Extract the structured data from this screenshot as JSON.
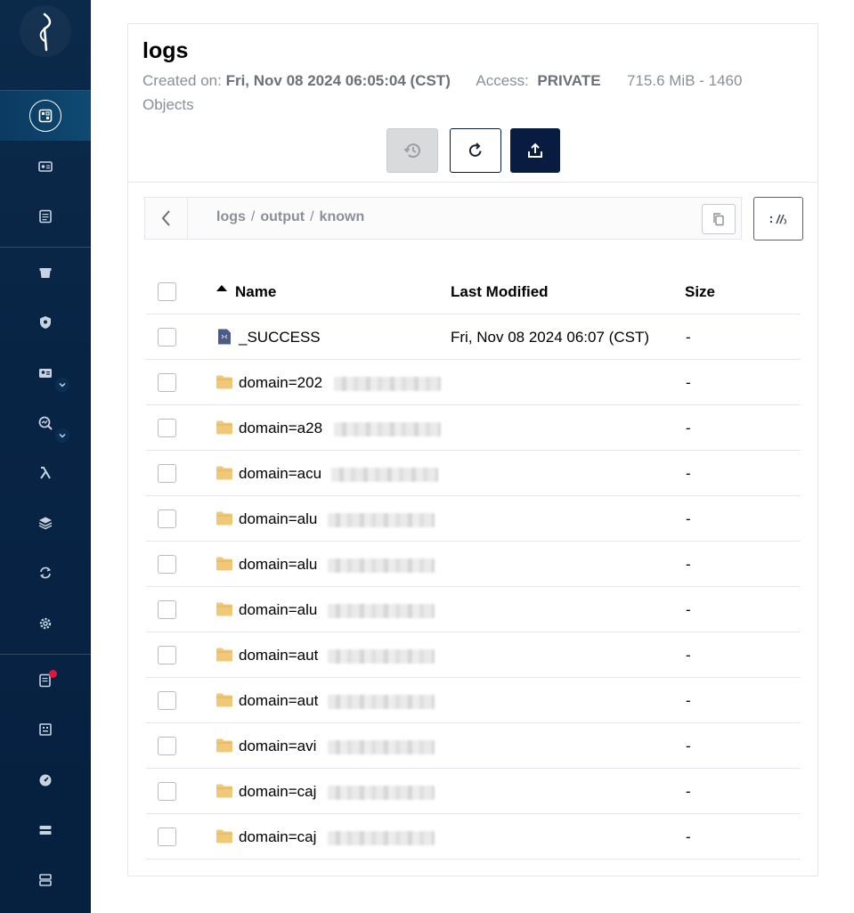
{
  "sidebar": {
    "items": [
      {
        "icon": "buckets-icon"
      },
      {
        "icon": "access-keys-icon"
      },
      {
        "icon": "documentation-icon"
      },
      {
        "icon": "storage-icon"
      },
      {
        "icon": "policies-icon"
      },
      {
        "icon": "identity-icon"
      },
      {
        "icon": "monitoring-icon"
      },
      {
        "icon": "lambda-icon"
      },
      {
        "icon": "tiers-icon"
      },
      {
        "icon": "replication-icon"
      },
      {
        "icon": "settings-icon"
      },
      {
        "icon": "license-icon"
      },
      {
        "icon": "support-icon"
      },
      {
        "icon": "metrics-icon"
      },
      {
        "icon": "drives-icon"
      },
      {
        "icon": "site-replication-icon"
      }
    ]
  },
  "bucket": {
    "name": "logs",
    "created_label": "Created on:",
    "created_value": "Fri, Nov 08 2024 06:05:04 (CST)",
    "access_label": "Access:",
    "access_value": "PRIVATE",
    "usage": "715.6 MiB - 1460 Objects"
  },
  "breadcrumb": {
    "parts": [
      "logs",
      "output",
      "known"
    ],
    "separator": "/"
  },
  "table": {
    "headers": {
      "name": "Name",
      "modified": "Last Modified",
      "size": "Size"
    },
    "rows": [
      {
        "type": "file",
        "name": "_SUCCESS",
        "modified": "Fri, Nov 08 2024 06:07 (CST)",
        "size": "-"
      },
      {
        "type": "folder",
        "name": "domain=202",
        "modified": "",
        "size": "-"
      },
      {
        "type": "folder",
        "name": "domain=a28",
        "modified": "",
        "size": "-"
      },
      {
        "type": "folder",
        "name": "domain=acu",
        "modified": "",
        "size": "-"
      },
      {
        "type": "folder",
        "name": "domain=alu",
        "modified": "",
        "size": "-"
      },
      {
        "type": "folder",
        "name": "domain=alu",
        "modified": "",
        "size": "-"
      },
      {
        "type": "folder",
        "name": "domain=alu",
        "modified": "",
        "size": "-"
      },
      {
        "type": "folder",
        "name": "domain=aut",
        "modified": "",
        "size": "-"
      },
      {
        "type": "folder",
        "name": "domain=aut",
        "modified": "",
        "size": "-"
      },
      {
        "type": "folder",
        "name": "domain=avi",
        "modified": "",
        "size": "-"
      },
      {
        "type": "folder",
        "name": "domain=caj",
        "modified": "",
        "size": "-"
      },
      {
        "type": "folder",
        "name": "domain=caj",
        "modified": "",
        "size": "-"
      }
    ]
  },
  "colors": {
    "sidebar": "#082445",
    "primary_button": "#081c42",
    "folder": "#f0c978",
    "notification": "#e0173b"
  }
}
